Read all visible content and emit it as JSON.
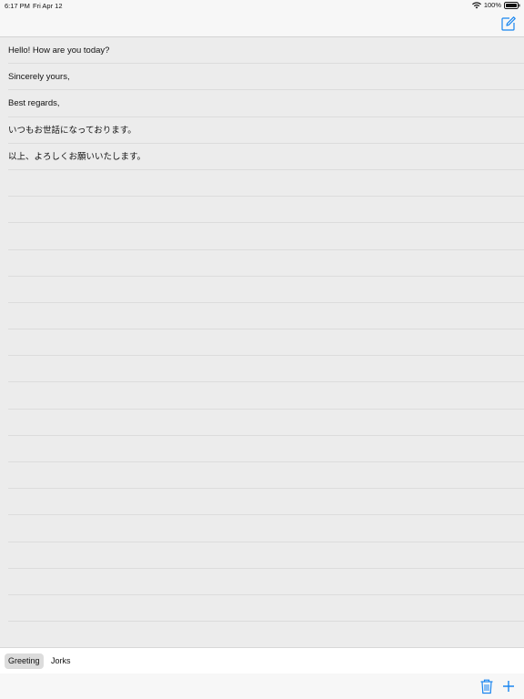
{
  "status_bar": {
    "time": "6:17 PM",
    "date": "Fri Apr 12",
    "battery": "100%"
  },
  "colors": {
    "accent": "#1a86f0",
    "list_background": "#ececec",
    "bar_background": "#f7f7f7"
  },
  "nav": {
    "compose_icon": "compose-icon"
  },
  "phrases": [
    "Hello! How are you today?",
    "Sincerely yours,",
    "Best regards,",
    "いつもお世話になっております。",
    "以上、よろしくお願いいたします。",
    "",
    "",
    "",
    "",
    "",
    "",
    "",
    "",
    "",
    "",
    "",
    "",
    "",
    "",
    "",
    "",
    "",
    ""
  ],
  "categories": {
    "selected": "Greeting",
    "items": [
      "Greeting",
      "Jorks"
    ]
  },
  "toolbar": {
    "delete_icon": "trash-icon",
    "add_icon": "plus-icon"
  }
}
